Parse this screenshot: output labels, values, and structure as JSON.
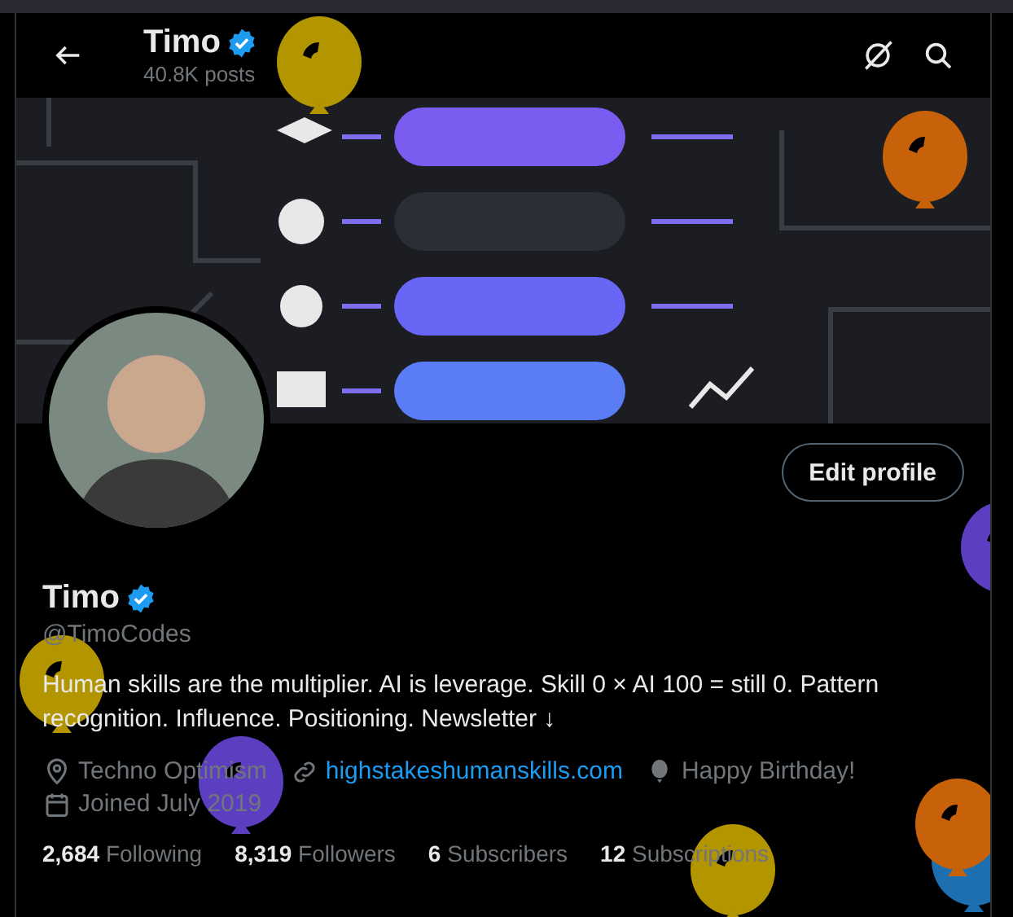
{
  "header": {
    "name": "Timo",
    "verified": true,
    "posts": "40.8K posts"
  },
  "edit_button": "Edit profile",
  "profile": {
    "name": "Timo",
    "verified": true,
    "handle": "@TimoCodes",
    "bio": "Human skills are the multiplier. AI is leverage. Skill 0 × AI 100 = still 0. Pattern recognition. Influence. Positioning. Newsletter ↓"
  },
  "meta": [
    {
      "kind": "location",
      "text": "Techno Optimism"
    },
    {
      "kind": "link",
      "text": "highstakeshumanskills.com"
    },
    {
      "kind": "birthday",
      "text": "Happy Birthday!"
    },
    {
      "kind": "joined",
      "text": "Joined July 2019"
    }
  ],
  "stats": [
    {
      "count": "2,684",
      "label": "Following"
    },
    {
      "count": "8,319",
      "label": "Followers"
    },
    {
      "count": "6",
      "label": "Subscribers"
    },
    {
      "count": "12",
      "label": "Subscriptions"
    }
  ],
  "balloons": [
    {
      "color": "#b39500"
    },
    {
      "color": "#c8620a"
    },
    {
      "color": "#5b3fc0"
    },
    {
      "color": "#b39500"
    },
    {
      "color": "#5b3fc0"
    },
    {
      "color": "#b39500"
    },
    {
      "color": "#1d6fb0"
    },
    {
      "color": "#c8620a"
    }
  ]
}
